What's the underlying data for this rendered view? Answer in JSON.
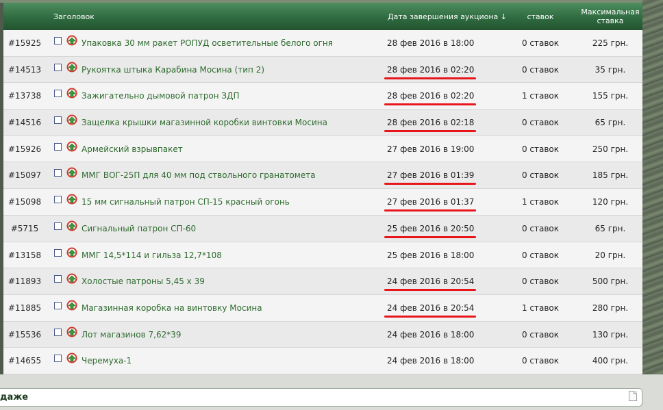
{
  "header": {
    "title": "Заголовок",
    "date": "Дата завершения аукциона ↓",
    "bids": "ставок",
    "max_bid": "Максимальная\nставка"
  },
  "rows": [
    {
      "id": "#15925",
      "title": "Упаковка 30 мм ракет РОПУД осветительные белого огня",
      "date": "28 фев 2016 в 18:00",
      "bids": "0 ставок",
      "price": "225 грн.",
      "underlined": false
    },
    {
      "id": "#14513",
      "title": "Рукоятка штыка Карабина Мосина (тип 2)",
      "date": "28 фев 2016 в 02:20",
      "bids": "0 ставок",
      "price": "35 грн.",
      "underlined": true
    },
    {
      "id": "#13738",
      "title": "Зажигательно дымовой патрон ЗДП",
      "date": "28 фев 2016 в 02:20",
      "bids": "1 ставок",
      "price": "155 грн.",
      "underlined": true
    },
    {
      "id": "#14516",
      "title": "Защелка крышки магазинной коробки винтовки Мосина",
      "date": "28 фев 2016 в 02:18",
      "bids": "0 ставок",
      "price": "65 грн.",
      "underlined": true
    },
    {
      "id": "#15926",
      "title": "Армейский взрывпакет",
      "date": "27 фев 2016 в 19:00",
      "bids": "0 ставок",
      "price": "250 грн.",
      "underlined": false
    },
    {
      "id": "#15097",
      "title": "ММГ ВОГ-25П для 40 мм под ствольного гранатомета",
      "date": "27 фев 2016 в 01:39",
      "bids": "0 ставок",
      "price": "185 грн.",
      "underlined": true
    },
    {
      "id": "#15098",
      "title": "15 мм сигнальный патрон СП-15 красный огонь",
      "date": "27 фев 2016 в 01:37",
      "bids": "1 ставок",
      "price": "120 грн.",
      "underlined": true
    },
    {
      "id": "#5715",
      "title": "Сигнальный патрон СП-60",
      "date": "25 фев 2016 в 20:50",
      "bids": "0 ставок",
      "price": "65 грн.",
      "underlined": true
    },
    {
      "id": "#13158",
      "title": "ММГ 14,5*114 и гильза 12,7*108",
      "date": "25 фев 2016 в 18:00",
      "bids": "0 ставок",
      "price": "20 грн.",
      "underlined": false
    },
    {
      "id": "#11893",
      "title": "Холостые патроны 5,45 х 39",
      "date": "24 фев 2016 в 20:54",
      "bids": "0 ставок",
      "price": "500 грн.",
      "underlined": true
    },
    {
      "id": "#11885",
      "title": "Магазинная коробка на винтовку Мосина",
      "date": "24 фев 2016 в 20:54",
      "bids": "1 ставок",
      "price": "280 грн.",
      "underlined": true
    },
    {
      "id": "#15536",
      "title": "Лот магазинов 7,62*39",
      "date": "24 фев 2016 в 18:00",
      "bids": "0 ставок",
      "price": "130 грн.",
      "underlined": false
    },
    {
      "id": "#14655",
      "title": "Черемуха-1",
      "date": "24 фев 2016 в 18:00",
      "bids": "0 ставок",
      "price": "400 грн.",
      "underlined": false
    }
  ],
  "footer": {
    "label": "даже"
  },
  "colors": {
    "header_green": "#2f6b40",
    "title_link": "#2e6b2e",
    "underline_red": "#e8161b"
  },
  "icons": {
    "row_icon": "green-red-arrow-icon",
    "footer_icon": "document-icon"
  }
}
